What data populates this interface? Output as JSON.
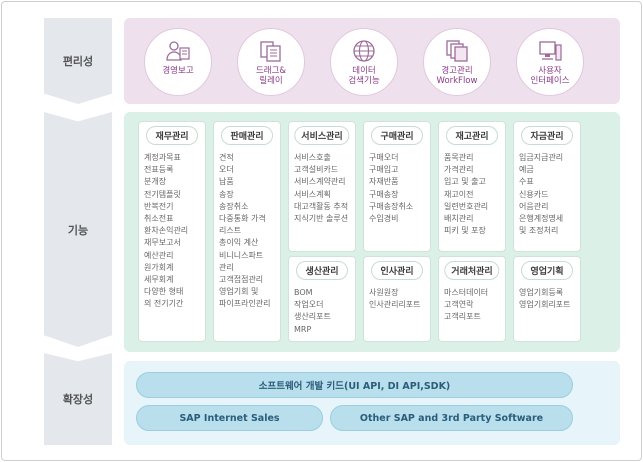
{
  "sections": {
    "convenience": "편리성",
    "function": "기능",
    "extensibility": "확장성"
  },
  "convenience_items": [
    {
      "label": "경영보고",
      "icon": "people-icon"
    },
    {
      "label": "드래그&\n릴레이",
      "icon": "documents-icon"
    },
    {
      "label": "데이터\n검색기능",
      "icon": "globe-icon"
    },
    {
      "label": "경고관리\nWorkFlow",
      "icon": "folders-icon"
    },
    {
      "label": "사용자\n인터페이스",
      "icon": "computer-icon"
    }
  ],
  "modules": [
    {
      "title": "재무관리",
      "items": [
        "계정과목표",
        "전표등록",
        "분개장",
        "전기템플릿",
        "반복전기",
        "취소전표",
        "환차손익관리",
        "재무보고서",
        "예산관리",
        "원가회계",
        "세무회계",
        "다양한 형태",
        "의 전기기간"
      ]
    },
    {
      "title": "판매관리",
      "items": [
        "견적",
        "오더",
        "납품",
        "송장",
        "송장취소",
        "다중통화 가격",
        "리스트",
        "총이익 계산",
        "비니니스파트",
        "관리",
        "고객접점관리",
        "영업기회 및",
        "파이프라인관리"
      ]
    },
    {
      "title": "서비스관리",
      "items": [
        "서비스호출",
        "고객설비카드",
        "서비스계약관리",
        "서비스계획",
        "대고객활동 추적",
        "지식기반 솔루션"
      ]
    },
    {
      "title": "구매관리",
      "items": [
        "구매오더",
        "구매입고",
        "자재반품",
        "구매송장",
        "구매송장취소",
        "수입경비"
      ]
    },
    {
      "title": "재고관리",
      "items": [
        "품목관리",
        "가격관리",
        "입고 및 출고",
        "재고이전",
        "일련번호관리",
        "배치관리",
        "피키 및 포장"
      ]
    },
    {
      "title": "자금관리",
      "items": [
        "입금지급관리",
        "예금",
        "수표",
        "신용카드",
        "어음관리",
        "은행계정명세",
        "및 조정처리"
      ]
    },
    {
      "title": "생산관리",
      "items": [
        "BOM",
        "작업오더",
        "생산리포트",
        "MRP"
      ]
    },
    {
      "title": "인사관리",
      "items": [
        "사원원장",
        "인사관리리포트"
      ]
    },
    {
      "title": "거래처관리",
      "items": [
        "마스터데이터",
        "고객연락",
        "고객리포트"
      ]
    },
    {
      "title": "영업기획",
      "items": [
        "영업기회등록",
        "영업기회리포트"
      ]
    }
  ],
  "extensibility": {
    "sdk": "소프트웨어 개발 키드(UI API, DI API,SDK)",
    "sales": "SAP Internet Sales",
    "other": "Other SAP and 3rd Party Software"
  }
}
